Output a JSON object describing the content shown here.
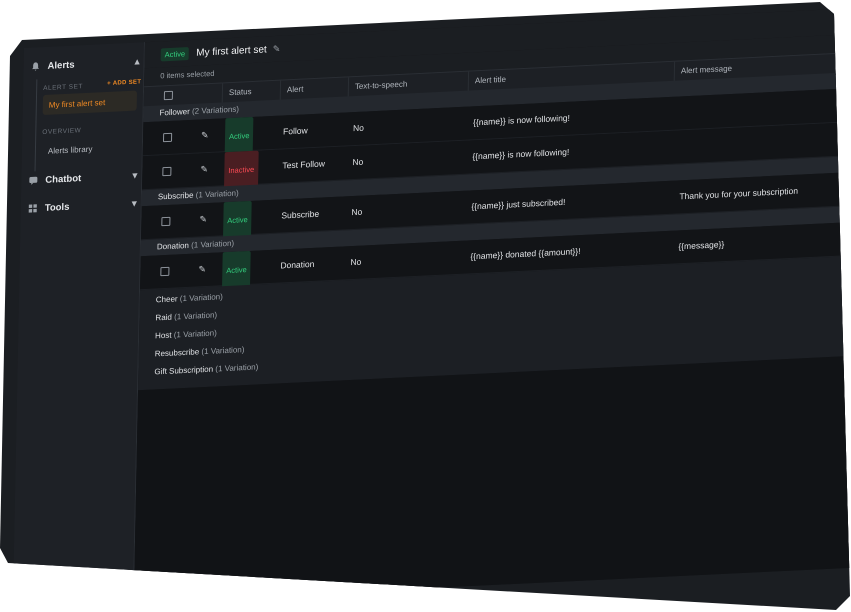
{
  "sidebar": {
    "alerts_label": "Alerts",
    "alert_set_label": "ALERT SET",
    "add_set_label": "+ ADD SET",
    "active_set": "My first alert set",
    "overview_label": "OVERVIEW",
    "alerts_library": "Alerts library",
    "chatbot_label": "Chatbot",
    "tools_label": "Tools"
  },
  "header": {
    "status": "Active",
    "title": "My first alert set"
  },
  "selection": {
    "text": "0 items selected"
  },
  "table": {
    "columns": [
      "Status",
      "Alert",
      "Text-to-speech",
      "Alert title",
      "Alert message"
    ]
  },
  "groups": {
    "follower": {
      "name": "Follower",
      "variations": "(2 Variations)"
    },
    "subscribe": {
      "name": "Subscribe",
      "variations": "(1 Variation)"
    },
    "donation": {
      "name": "Donation",
      "variations": "(1 Variation)"
    }
  },
  "rows": [
    {
      "status": "Active",
      "alert": "Follow",
      "tts": "No",
      "title": "{{name}} is now following!",
      "message": ""
    },
    {
      "status": "Inactive",
      "alert": "Test Follow",
      "tts": "No",
      "title": "{{name}} is now following!",
      "message": ""
    },
    {
      "status": "Active",
      "alert": "Subscribe",
      "tts": "No",
      "title": "{{name}} just subscribed!",
      "message": "Thank you for your subscription"
    },
    {
      "status": "Active",
      "alert": "Donation",
      "tts": "No",
      "title": "{{name}} donated {{amount}}!",
      "message": "{{message}}"
    }
  ],
  "categories": [
    {
      "name": "Cheer",
      "variations": "(1 Variation)"
    },
    {
      "name": "Raid",
      "variations": "(1 Variation)"
    },
    {
      "name": "Host",
      "variations": "(1 Variation)"
    },
    {
      "name": "Resubscribe",
      "variations": "(1 Variation)"
    },
    {
      "name": "Gift Subscription",
      "variations": "(1 Variation)"
    }
  ],
  "colors": {
    "accent": "#f08a24",
    "active": "#34d07f",
    "inactive": "#ff4b55",
    "background": "#15171a"
  }
}
